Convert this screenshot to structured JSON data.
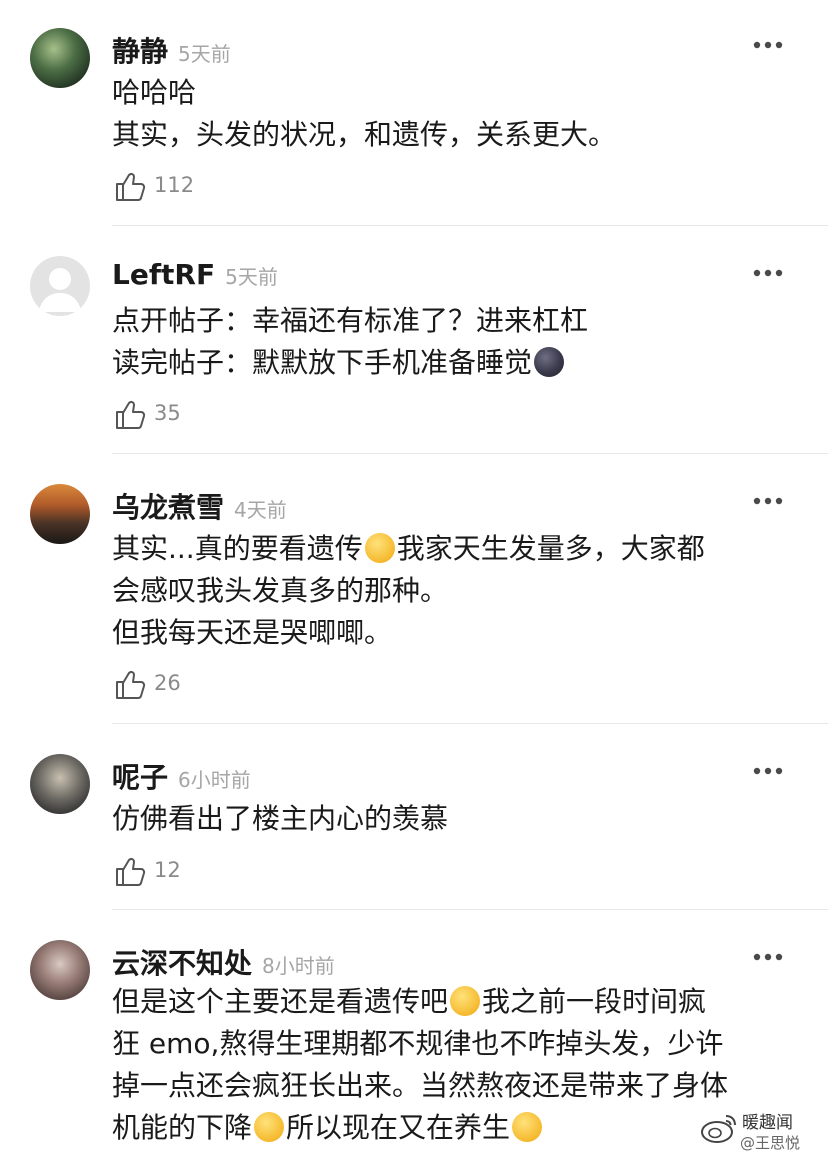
{
  "comments": [
    {
      "username": "静静",
      "time": "5天前",
      "lines": [
        "哈哈哈",
        "其实，头发的状况，和遗传，关系更大。"
      ],
      "likes": "112"
    },
    {
      "username": "LeftRF",
      "time": "5天前",
      "lines": [
        "点开帖子：幸福还有标准了？进来杠杠",
        "读完帖子：默默放下手机准备睡觉"
      ],
      "likes": "35"
    },
    {
      "username": "乌龙煮雪",
      "time": "4天前",
      "line1a": "其实...真的要看遗传",
      "line1b": "我家天生发量多，大家都",
      "lines_rest": [
        "会感叹我头发真多的那种。",
        "但我每天还是哭唧唧。"
      ],
      "likes": "26"
    },
    {
      "username": "呢子",
      "time": "6小时前",
      "lines": [
        "仿佛看出了楼主内心的羡慕"
      ],
      "likes": "12"
    },
    {
      "username": "云深不知处",
      "time": "8小时前",
      "line1a": "但是这个主要还是看遗传吧",
      "line1b": "我之前一段时间疯",
      "line2": "狂 emo,熬得生理期都不规律也不咋掉头发，少许",
      "line3": "掉一点还会疯狂长出来。当然熬夜还是带来了身体",
      "line4a": "机能的下降",
      "line4b": "所以现在又在养生"
    }
  ],
  "watermark": {
    "name": "暖趣闻",
    "handle": "@王思悦"
  }
}
